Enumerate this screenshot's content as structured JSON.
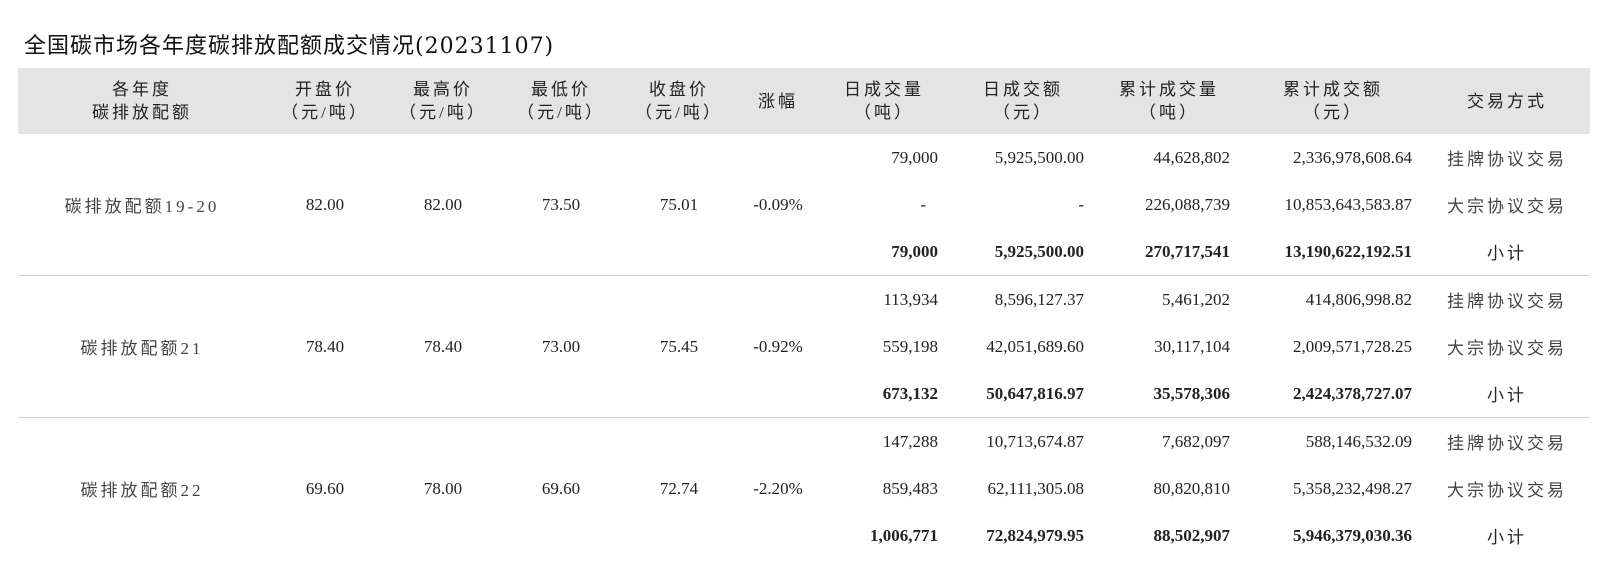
{
  "title": "全国碳市场各年度碳排放配额成交情况(20231107)",
  "headers": [
    [
      "各年度",
      "碳排放配额"
    ],
    [
      "开盘价",
      "（元/吨）"
    ],
    [
      "最高价",
      "（元/吨）"
    ],
    [
      "最低价",
      "（元/吨）"
    ],
    [
      "收盘价",
      "（元/吨）"
    ],
    [
      "涨幅"
    ],
    [
      "日成交量",
      "（吨）"
    ],
    [
      "日成交额",
      "（元）"
    ],
    [
      "累计成交量",
      "（吨）"
    ],
    [
      "累计成交额",
      "（元）"
    ],
    [
      "交易方式"
    ]
  ],
  "groups": [
    {
      "name": "碳排放配额19-20",
      "open": "82.00",
      "high": "82.00",
      "low": "73.50",
      "close": "75.01",
      "change": "-0.09%",
      "rows": [
        {
          "vol": "79,000",
          "amt": "5,925,500.00",
          "cum_vol": "44,628,802",
          "cum_amt": "2,336,978,608.64",
          "type": "挂牌协议交易"
        },
        {
          "vol": "-",
          "amt": "-",
          "cum_vol": "226,088,739",
          "cum_amt": "10,853,643,583.87",
          "type": "大宗协议交易"
        },
        {
          "vol": "79,000",
          "amt": "5,925,500.00",
          "cum_vol": "270,717,541",
          "cum_amt": "13,190,622,192.51",
          "type": "小计"
        }
      ]
    },
    {
      "name": "碳排放配额21",
      "open": "78.40",
      "high": "78.40",
      "low": "73.00",
      "close": "75.45",
      "change": "-0.92%",
      "rows": [
        {
          "vol": "113,934",
          "amt": "8,596,127.37",
          "cum_vol": "5,461,202",
          "cum_amt": "414,806,998.82",
          "type": "挂牌协议交易"
        },
        {
          "vol": "559,198",
          "amt": "42,051,689.60",
          "cum_vol": "30,117,104",
          "cum_amt": "2,009,571,728.25",
          "type": "大宗协议交易"
        },
        {
          "vol": "673,132",
          "amt": "50,647,816.97",
          "cum_vol": "35,578,306",
          "cum_amt": "2,424,378,727.07",
          "type": "小计"
        }
      ]
    },
    {
      "name": "碳排放配额22",
      "open": "69.60",
      "high": "78.00",
      "low": "69.60",
      "close": "72.74",
      "change": "-2.20%",
      "rows": [
        {
          "vol": "147,288",
          "amt": "10,713,674.87",
          "cum_vol": "7,682,097",
          "cum_amt": "588,146,532.09",
          "type": "挂牌协议交易"
        },
        {
          "vol": "859,483",
          "amt": "62,111,305.08",
          "cum_vol": "80,820,810",
          "cum_amt": "5,358,232,498.27",
          "type": "大宗协议交易"
        },
        {
          "vol": "1,006,771",
          "amt": "72,824,979.95",
          "cum_vol": "88,502,907",
          "cum_amt": "5,946,379,030.36",
          "type": "小计"
        }
      ]
    }
  ]
}
